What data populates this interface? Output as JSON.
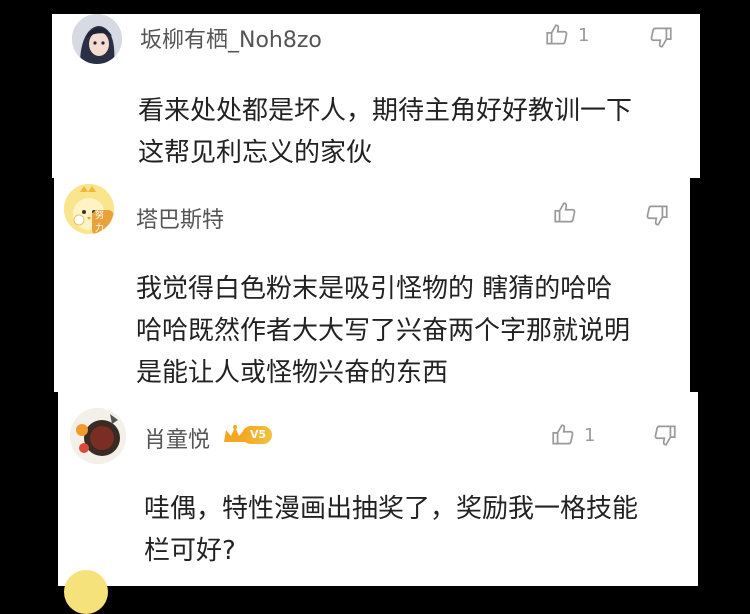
{
  "comments": [
    {
      "username": "坂柳有栖_Noh8zo",
      "likes": "1",
      "text_lines": [
        "看来处处都是坏人，期待主角好好教训一下",
        "这帮见利忘义的家伙"
      ],
      "avatar_icon": "anime-girl-avatar-icon"
    },
    {
      "username": "塔巴斯特",
      "likes": "",
      "text_lines": [
        "我觉得白色粉末是吸引怪物的 瞎猜的哈哈",
        "哈哈既然作者大大写了兴奋两个字那就说明",
        "是能让人或怪物兴奋的东西"
      ],
      "avatar_icon": "chick-avatar-icon",
      "avatar_badge": "努力"
    },
    {
      "username": "肖童悦",
      "likes": "1",
      "vip_level": "V5",
      "text_lines": [
        "哇偶，特性漫画出抽奖了，奖励我一格技能",
        "栏可好?"
      ],
      "avatar_icon": "halloween-avatar-icon"
    }
  ],
  "colors": {
    "background": "#000000",
    "card": "#ffffff",
    "username": "#555555",
    "content": "#222222",
    "icon_gray": "#9a9a9a",
    "vip_gold": "#f5a623"
  }
}
